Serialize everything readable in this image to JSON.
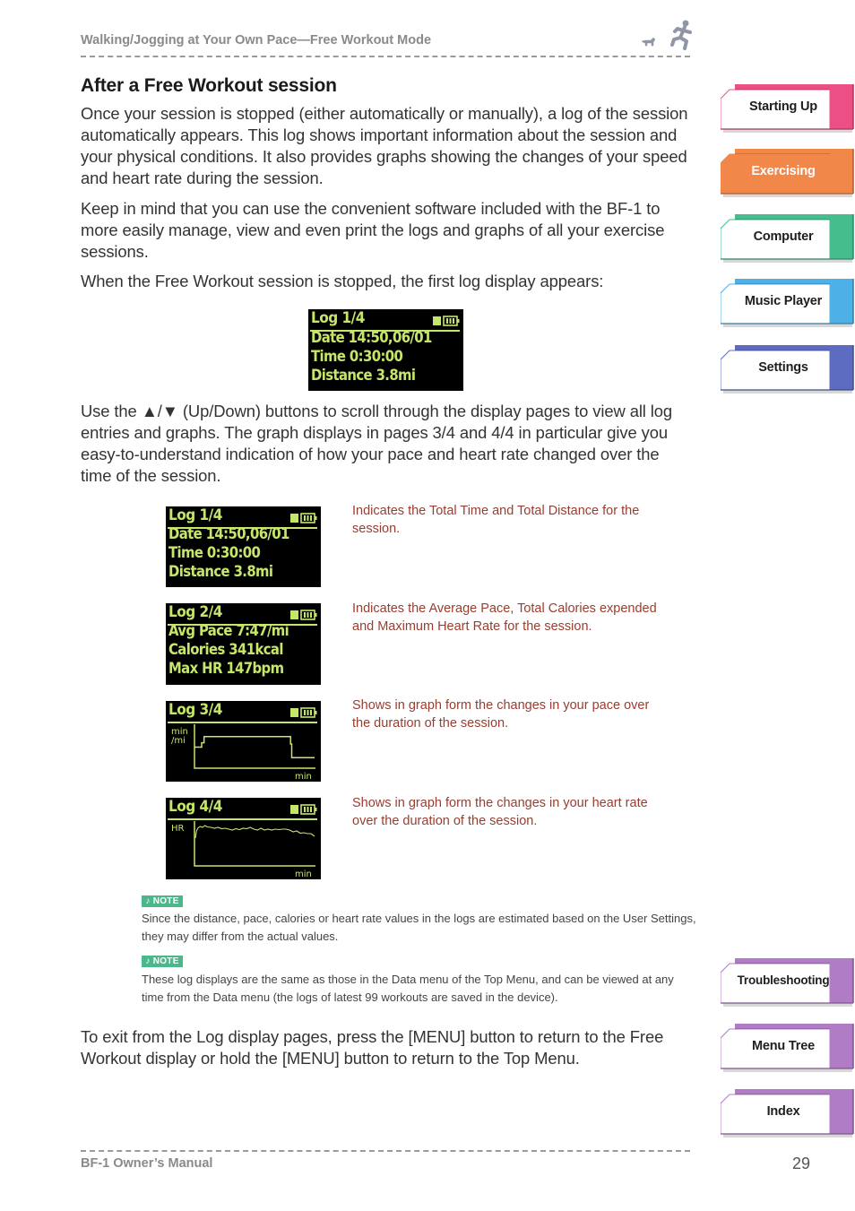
{
  "header": {
    "title": "Walking/Jogging at Your Own Pace—Free Workout Mode",
    "icon": "runner-with-dog-icon"
  },
  "section": {
    "title": "After a Free Workout session",
    "paragraphs": [
      "Once your session is stopped (either automatically or manually), a log of the session automatically appears. This log shows important information about the session and your physical conditions. It also provides graphs showing the changes of your speed and heart rate during the session.",
      "Keep in mind that you can use the convenient software included with the BF-1 to more easily manage, view and even print the logs and graphs of all your exercise sessions.",
      "When the Free Workout session is stopped, the first log display appears:",
      "Use the ▲/▼ (Up/Down) buttons to scroll through the display pages to view all log entries and graphs. The graph displays in pages 3/4 and 4/4 in particular give you easy-to-understand indication of how your pace and heart rate changed over the time of the session.",
      "To exit from the Log display pages, press the [MENU] button to return to the Free Workout display or hold the [MENU] button to return to the Top Menu."
    ]
  },
  "lcd_colors": {
    "background": "#000000",
    "foreground": "#c6e66a"
  },
  "first_display": {
    "title": "Log 1/4",
    "rows": [
      "Date 14:50,06/01",
      "Time 0:30:00",
      "Distance 3.8mi"
    ]
  },
  "log_pages": [
    {
      "title": "Log 1/4",
      "rows": [
        "Date 14:50,06/01",
        "Time 0:30:00",
        "Distance 3.8mi"
      ],
      "caption": "Indicates the Total Time and Total Distance for the session."
    },
    {
      "title": "Log 2/4",
      "rows": [
        "Avg Pace 7:47/mi",
        "Calories 341kcal",
        "Max HR 147bpm"
      ],
      "caption": "Indicates the Average Pace, Total Calories expended and Maximum Heart Rate for the session."
    },
    {
      "title": "Log 3/4",
      "y_label_1": "min",
      "y_label_2": "/mi",
      "x_label": "min",
      "caption": "Shows in graph form the changes in your pace over the duration of the session."
    },
    {
      "title": "Log 4/4",
      "y_label": "HR",
      "x_label": "min",
      "caption": "Shows in graph form the changes in your heart rate over the duration of the session."
    }
  ],
  "pace_graph": {
    "description": "step profile of pace (relative, 0..1 of plot height) over session time (0..1)",
    "points": [
      [
        0,
        0.48
      ],
      [
        0.06,
        0.48
      ],
      [
        0.06,
        0.58
      ],
      [
        0.08,
        0.58
      ],
      [
        0.08,
        0.72
      ],
      [
        0.8,
        0.72
      ],
      [
        0.8,
        0.55
      ],
      [
        0.81,
        0.55
      ],
      [
        0.81,
        0.24
      ],
      [
        1,
        0.24
      ]
    ]
  },
  "hr_graph": {
    "description": "heart-rate trace (relative, 0..1 of plot height) over session time (0..1)",
    "points": [
      [
        0,
        0.62
      ],
      [
        0.01,
        0.78
      ],
      [
        0.02,
        0.84
      ],
      [
        0.04,
        0.88
      ],
      [
        0.06,
        0.86
      ],
      [
        0.08,
        0.9
      ],
      [
        0.1,
        0.87
      ],
      [
        0.13,
        0.86
      ],
      [
        0.16,
        0.84
      ],
      [
        0.19,
        0.86
      ],
      [
        0.22,
        0.83
      ],
      [
        0.25,
        0.84
      ],
      [
        0.28,
        0.82
      ],
      [
        0.31,
        0.8
      ],
      [
        0.34,
        0.83
      ],
      [
        0.37,
        0.81
      ],
      [
        0.4,
        0.84
      ],
      [
        0.43,
        0.83
      ],
      [
        0.46,
        0.86
      ],
      [
        0.49,
        0.82
      ],
      [
        0.52,
        0.8
      ],
      [
        0.55,
        0.84
      ],
      [
        0.58,
        0.8
      ],
      [
        0.61,
        0.82
      ],
      [
        0.64,
        0.8
      ],
      [
        0.67,
        0.82
      ],
      [
        0.7,
        0.81
      ],
      [
        0.73,
        0.82
      ],
      [
        0.76,
        0.82
      ],
      [
        0.79,
        0.8
      ],
      [
        0.82,
        0.76
      ],
      [
        0.85,
        0.78
      ],
      [
        0.88,
        0.73
      ],
      [
        0.91,
        0.74
      ],
      [
        0.94,
        0.72
      ],
      [
        0.97,
        0.72
      ],
      [
        1,
        0.66
      ]
    ]
  },
  "notes": [
    {
      "badge": "♪ NOTE",
      "text": "Since the distance, pace, calories or heart rate values in the logs are estimated based on the User Settings, they may differ from the actual values."
    },
    {
      "badge": "♪ NOTE",
      "text": "These log displays are the same as those in the Data menu of the Top Menu, and can be viewed at any time from the Data menu (the logs of latest 99 workouts are saved in the device)."
    }
  ],
  "footer": {
    "title": "BF-1 Owner’s Manual",
    "page_number": "29"
  },
  "side_tabs": [
    {
      "label": "Starting Up",
      "color": "#ec4f86",
      "active": false
    },
    {
      "label": "Exercising",
      "color": "#f2874a",
      "active": true
    },
    {
      "label": "Computer",
      "color": "#45bd8d",
      "active": false
    },
    {
      "label": "Music Player",
      "color": "#4db0e6",
      "active": false
    },
    {
      "label": "Settings",
      "color": "#5d6cc0",
      "active": false
    },
    {
      "label": "Troubleshooting",
      "color": "#b07cc6",
      "active": false
    },
    {
      "label": "Menu Tree",
      "color": "#b07cc6",
      "active": false
    },
    {
      "label": "Index",
      "color": "#b07cc6",
      "active": false
    }
  ]
}
